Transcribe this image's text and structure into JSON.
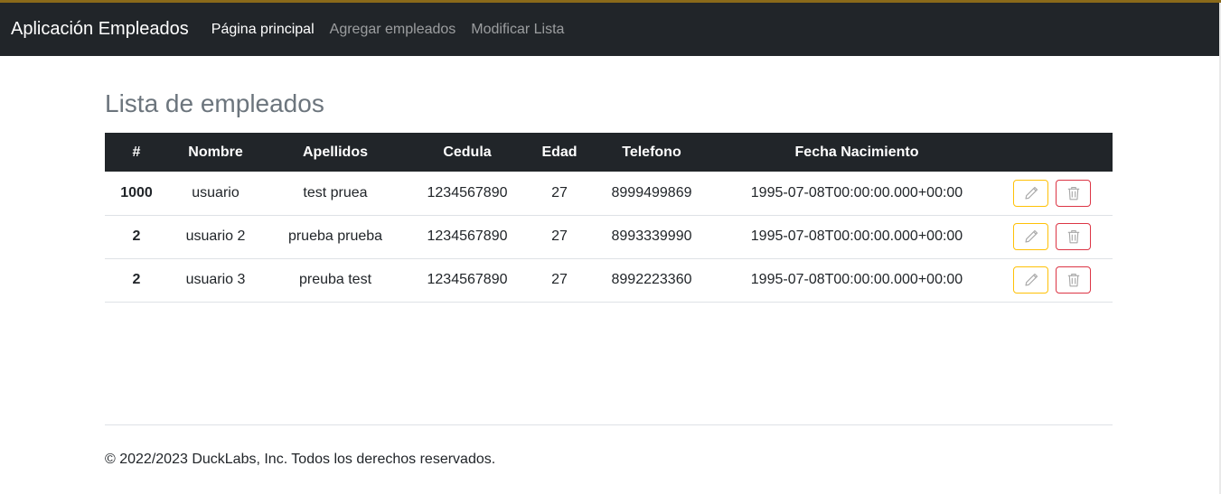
{
  "nav": {
    "brand": "Aplicación Empleados",
    "links": [
      "Página principal",
      "Agregar empleados",
      "Modificar Lista"
    ]
  },
  "main": {
    "title": "Lista de empleados",
    "table": {
      "headers": [
        "#",
        "Nombre",
        "Apellidos",
        "Cedula",
        "Edad",
        "Telefono",
        "Fecha Nacimiento",
        ""
      ],
      "rows": [
        [
          "1000",
          "usuario",
          "test pruea",
          "1234567890",
          "27",
          "8999499869",
          "1995-07-08T00:00:00.000+00:00"
        ],
        [
          "2",
          "usuario 2",
          "prueba prueba",
          "1234567890",
          "27",
          "8993339990",
          "1995-07-08T00:00:00.000+00:00"
        ],
        [
          "2",
          "usuario 3",
          "preuba test",
          "1234567890",
          "27",
          "8992223360",
          "1995-07-08T00:00:00.000+00:00"
        ]
      ],
      "row_actions": [
        "pencil-icon",
        "trash-icon"
      ]
    }
  },
  "footer": {
    "text": "© 2022/2023 DuckLabs, Inc. Todos los derechos reservados."
  },
  "colors": {
    "navbar": "#212529",
    "edit_border": "#ffc107",
    "delete_border": "#dc3545",
    "title": "#6c757d"
  }
}
